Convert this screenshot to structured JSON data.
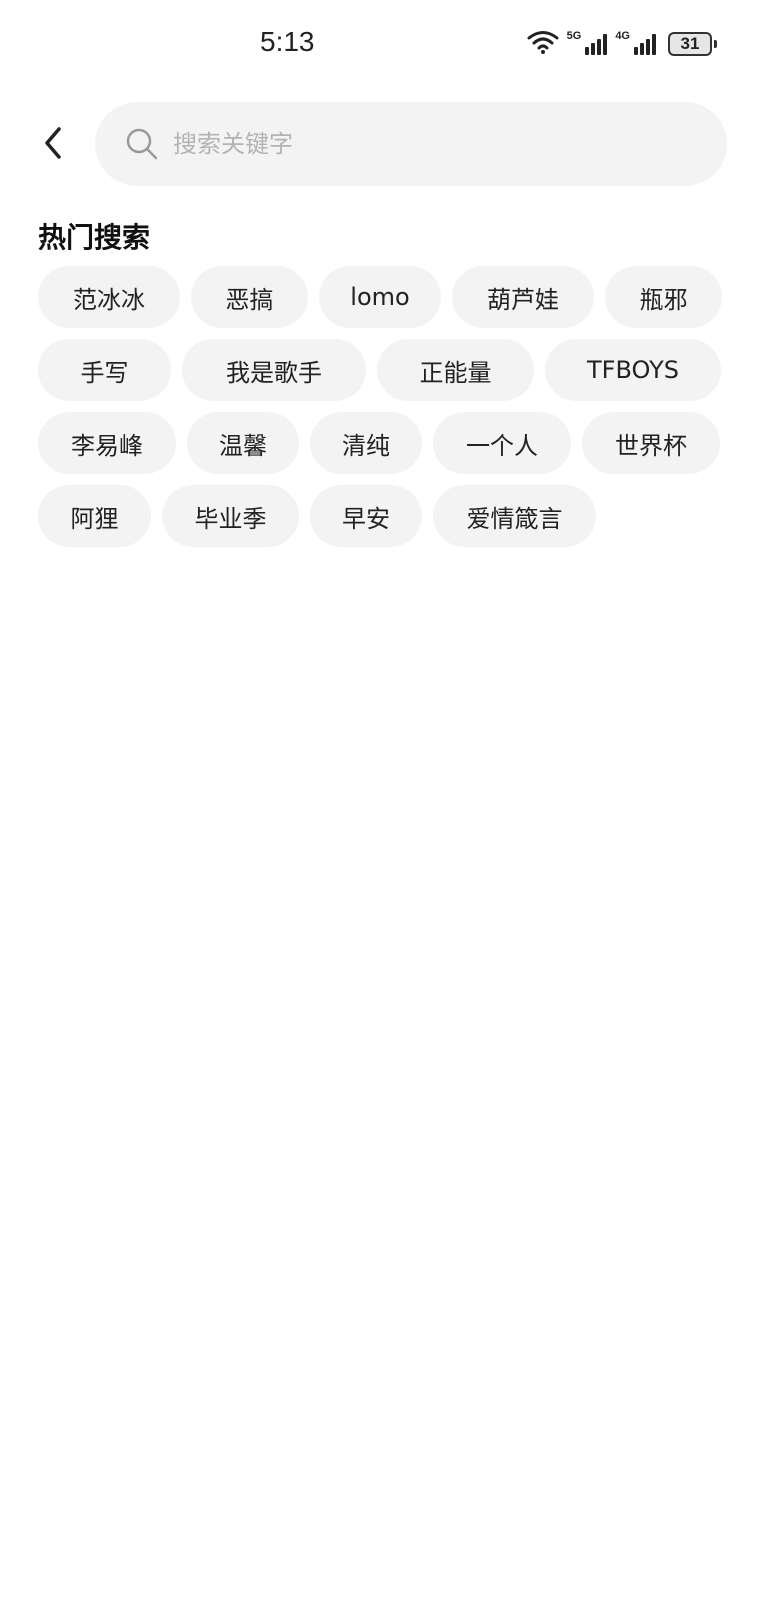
{
  "status_bar": {
    "time": "5:13",
    "network_5g": "5G",
    "network_4g": "4G",
    "battery": "31"
  },
  "search": {
    "placeholder": "搜索关键字",
    "value": ""
  },
  "hot_search": {
    "title": "热门搜索",
    "rows": [
      [
        "范冰冰",
        "恶搞",
        "lomo",
        "葫芦娃",
        "瓶邪"
      ],
      [
        "手写",
        "我是歌手",
        "正能量",
        "TFBOYS"
      ],
      [
        "李易峰",
        "温馨",
        "清纯",
        "一个人",
        "世界杯"
      ],
      [
        "阿狸",
        "毕业季",
        "早安",
        "爱情箴言"
      ]
    ]
  },
  "icons": {
    "back": "chevron-left-icon",
    "search": "search-icon",
    "wifi": "wifi-icon",
    "signal": "signal-icon",
    "battery": "battery-icon"
  },
  "colors": {
    "background": "#ffffff",
    "chip": "#f3f3f3",
    "placeholder": "#b3b3b3",
    "text": "#222222"
  }
}
